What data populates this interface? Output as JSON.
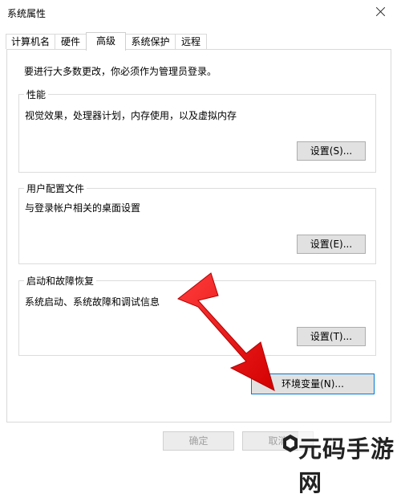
{
  "window": {
    "title": "系统属性"
  },
  "tabs": [
    {
      "label": "计算机名"
    },
    {
      "label": "硬件"
    },
    {
      "label": "高级",
      "active": true
    },
    {
      "label": "系统保护"
    },
    {
      "label": "远程"
    }
  ],
  "note": "要进行大多数更改，你必须作为管理员登录。",
  "performance": {
    "legend": "性能",
    "description": "视觉效果，处理器计划，内存使用，以及虚拟内存",
    "button": "设置(S)..."
  },
  "profiles": {
    "legend": "用户配置文件",
    "description": "与登录帐户相关的桌面设置",
    "button": "设置(E)..."
  },
  "startup": {
    "legend": "启动和故障恢复",
    "description": "系统启动、系统故障和调试信息",
    "button": "设置(T)..."
  },
  "env_button": "环境变量(N)...",
  "footer": {
    "ok": "确定",
    "cancel": "取消"
  },
  "watermark": "元码手游网",
  "colors": {
    "arrow": "#ff2a2a",
    "focus_border": "#0078d7"
  }
}
